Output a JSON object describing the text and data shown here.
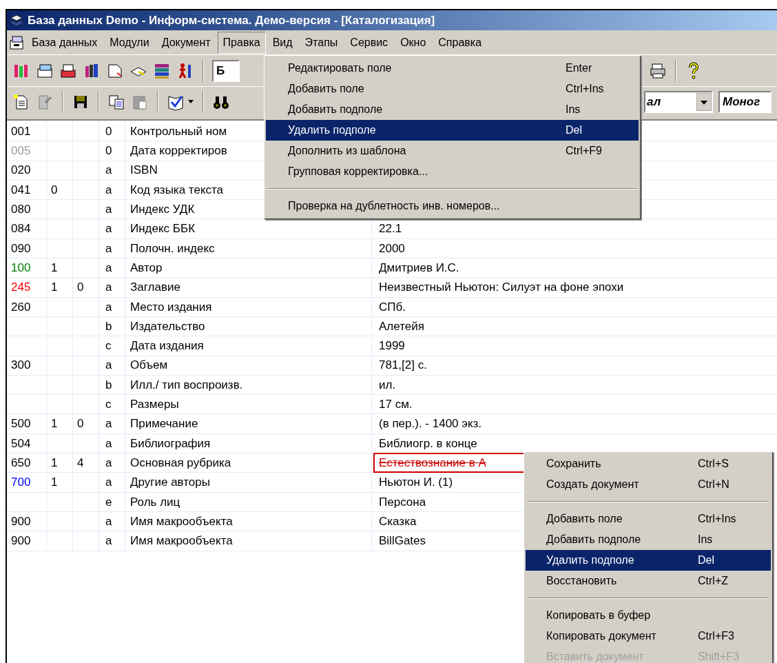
{
  "window": {
    "title": "База данных Demo - Информ-система. Демо-версия - [Каталогизация]"
  },
  "menu_bar": [
    {
      "label": "База данных",
      "selected": false
    },
    {
      "label": "Модули",
      "selected": false
    },
    {
      "label": "Документ",
      "selected": false
    },
    {
      "label": "Правка",
      "selected": true
    },
    {
      "label": "Вид",
      "selected": false
    },
    {
      "label": "Этапы",
      "selected": false
    },
    {
      "label": "Сервис",
      "selected": false
    },
    {
      "label": "Окно",
      "selected": false
    },
    {
      "label": "Справка",
      "selected": false
    }
  ],
  "toolbar": {
    "field_value": "Б",
    "combo_1": "ал",
    "combo_2": "Моног"
  },
  "table": {
    "rows": [
      {
        "tag": "001",
        "color": "#000000",
        "ind1": "",
        "ind2": "",
        "code": "0",
        "name": "Контрольный ном",
        "value": "",
        "error": false
      },
      {
        "tag": "005",
        "color": "#9a9a9a",
        "ind1": "",
        "ind2": "",
        "code": "0",
        "name": "Дата корректиров",
        "value": "",
        "error": false
      },
      {
        "tag": "020",
        "color": "#000000",
        "ind1": "",
        "ind2": "",
        "code": "a",
        "name": "ISBN",
        "value": "",
        "error": false
      },
      {
        "tag": "041",
        "color": "#000000",
        "ind1": "0",
        "ind2": "",
        "code": "a",
        "name": "Код языка текста",
        "value": "",
        "error": false
      },
      {
        "tag": "080",
        "color": "#000000",
        "ind1": "",
        "ind2": "",
        "code": "a",
        "name": "Индекс УДК",
        "value": "",
        "error": false
      },
      {
        "tag": "084",
        "color": "#000000",
        "ind1": "",
        "ind2": "",
        "code": "a",
        "name": "Индекс ББК",
        "value": "22.1",
        "error": false
      },
      {
        "tag": "090",
        "color": "#000000",
        "ind1": "",
        "ind2": "",
        "code": "a",
        "name": "Полочн. индекс",
        "value": "2000",
        "error": false
      },
      {
        "tag": "100",
        "color": "#008000",
        "ind1": "1",
        "ind2": "",
        "code": "a",
        "name": "Автор",
        "value": "Дмитриев И.С.",
        "error": false
      },
      {
        "tag": "245",
        "color": "#ff0000",
        "ind1": "1",
        "ind2": "0",
        "code": "a",
        "name": "Заглавие",
        "value": "Неизвестный Ньютон: Силуэт на фоне эпохи",
        "error": false
      },
      {
        "tag": "260",
        "color": "#000000",
        "ind1": "",
        "ind2": "",
        "code": "a",
        "name": "Место издания",
        "value": "СПб.",
        "error": false
      },
      {
        "tag": "",
        "ind1": "",
        "ind2": "",
        "code": "b",
        "name": "Издательство",
        "value": "Алетейя",
        "error": false
      },
      {
        "tag": "",
        "ind1": "",
        "ind2": "",
        "code": "c",
        "name": "Дата издания",
        "value": "1999",
        "error": false
      },
      {
        "tag": "300",
        "color": "#000000",
        "ind1": "",
        "ind2": "",
        "code": "a",
        "name": "Объем",
        "value": "781,[2] с.",
        "error": false
      },
      {
        "tag": "",
        "ind1": "",
        "ind2": "",
        "code": "b",
        "name": "Илл./ тип воспроизв.",
        "value": "ил.",
        "error": false
      },
      {
        "tag": "",
        "ind1": "",
        "ind2": "",
        "code": "c",
        "name": "Размеры",
        "value": "17 см.",
        "error": false
      },
      {
        "tag": "500",
        "color": "#000000",
        "ind1": "1",
        "ind2": "0",
        "code": "a",
        "name": "Примечание",
        "value": "(в пер.). - 1400 экз.",
        "error": false
      },
      {
        "tag": "504",
        "color": "#000000",
        "ind1": "",
        "ind2": "",
        "code": "a",
        "name": "Библиография",
        "value": "Библиогр. в конце",
        "error": false
      },
      {
        "tag": "650",
        "color": "#000000",
        "ind1": "1",
        "ind2": "4",
        "code": "a",
        "name": "Основная рубрика",
        "value": "Естествознание в А",
        "error": true
      },
      {
        "tag": "700",
        "color": "#0000ff",
        "ind1": "1",
        "ind2": "",
        "code": "a",
        "name": "Другие авторы",
        "value": "Ньютон И. (1)",
        "error": false
      },
      {
        "tag": "",
        "ind1": "",
        "ind2": "",
        "code": "e",
        "name": "Роль лиц",
        "value": "Персона",
        "error": false
      },
      {
        "tag": "900",
        "color": "#000000",
        "ind1": "",
        "ind2": "",
        "code": "a",
        "name": "Имя макрообъекта",
        "value": "Сказка",
        "error": false
      },
      {
        "tag": "900",
        "color": "#000000",
        "ind1": "",
        "ind2": "",
        "code": "a",
        "name": "Имя макрообъекта",
        "value": "BillGates",
        "error": false
      }
    ]
  },
  "dropdown_menu": [
    {
      "kind": "item",
      "label": "Редактировать поле",
      "shortcut": "Enter",
      "selected": false,
      "disabled": false
    },
    {
      "kind": "item",
      "label": "Добавить поле",
      "shortcut": "Ctrl+Ins",
      "selected": false,
      "disabled": false
    },
    {
      "kind": "item",
      "label": "Добавить подполе",
      "shortcut": "Ins",
      "selected": false,
      "disabled": false
    },
    {
      "kind": "item",
      "label": "Удалить подполе",
      "shortcut": "Del",
      "selected": true,
      "disabled": false
    },
    {
      "kind": "item",
      "label": "Дополнить из шаблона",
      "shortcut": "Ctrl+F9",
      "selected": false,
      "disabled": false
    },
    {
      "kind": "item",
      "label": "Групповая корректировка...",
      "selected": false,
      "disabled": false
    },
    {
      "kind": "separator"
    },
    {
      "kind": "item",
      "label": "Проверка на дублетность инв. номеров...",
      "selected": false,
      "disabled": false
    }
  ],
  "context_menu": [
    {
      "kind": "item",
      "label": "Сохранить",
      "shortcut": "Ctrl+S",
      "selected": false,
      "disabled": false
    },
    {
      "kind": "item",
      "label": "Создать документ",
      "shortcut": "Ctrl+N",
      "selected": false,
      "disabled": false
    },
    {
      "kind": "separator"
    },
    {
      "kind": "item",
      "label": "Добавить поле",
      "shortcut": "Ctrl+Ins",
      "selected": false,
      "disabled": false
    },
    {
      "kind": "item",
      "label": "Добавить подполе",
      "shortcut": "Ins",
      "selected": false,
      "disabled": false
    },
    {
      "kind": "item",
      "label": "Удалить подполе",
      "shortcut": "Del",
      "selected": true,
      "disabled": false
    },
    {
      "kind": "item",
      "label": "Восстановить",
      "shortcut": "Ctrl+Z",
      "selected": false,
      "disabled": false
    },
    {
      "kind": "separator"
    },
    {
      "kind": "item",
      "label": "Копировать в буфер",
      "selected": false,
      "disabled": false
    },
    {
      "kind": "item",
      "label": "Копировать документ",
      "shortcut": "Ctrl+F3",
      "selected": false,
      "disabled": false
    },
    {
      "kind": "item",
      "label": "Вставить документ",
      "shortcut": "Shift+F3",
      "selected": false,
      "disabled": true
    }
  ]
}
